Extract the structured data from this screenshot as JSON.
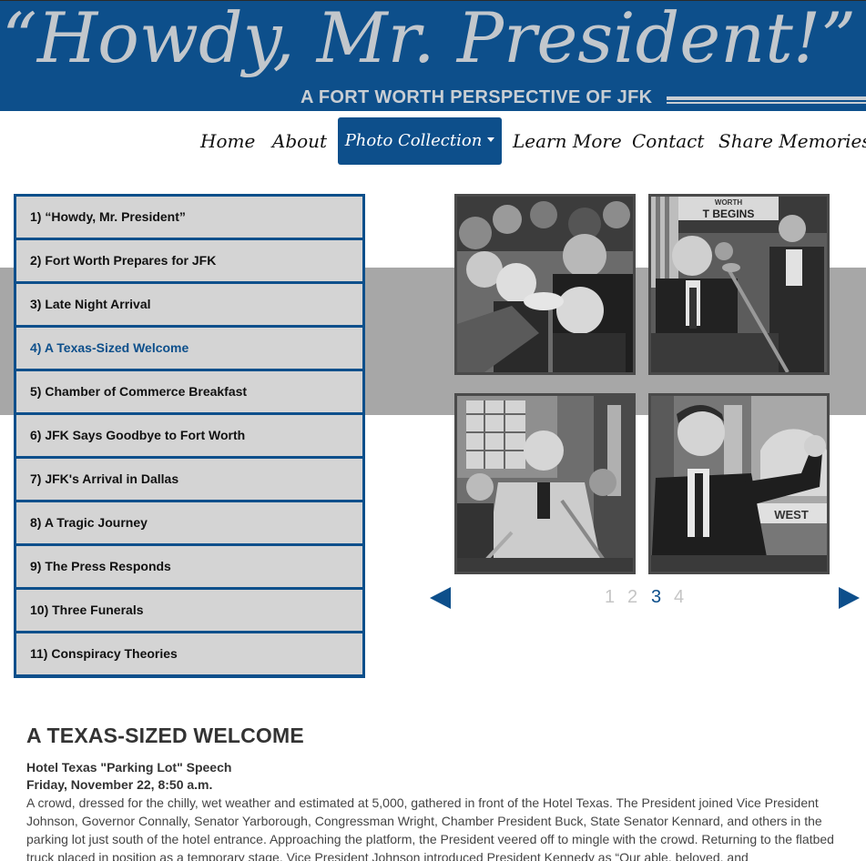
{
  "header": {
    "title": "“Howdy, Mr. President!”",
    "subtitle": "A FORT WORTH PERSPECTIVE OF JFK"
  },
  "nav": {
    "items": [
      {
        "label": "Home"
      },
      {
        "label": "About"
      },
      {
        "label": "Photo Collection",
        "active": true
      },
      {
        "label": "Learn More"
      },
      {
        "label": "Contact"
      },
      {
        "label": "Share Memories"
      }
    ]
  },
  "chapters": [
    {
      "label": "1) “Howdy, Mr. President”"
    },
    {
      "label": "2) Fort Worth Prepares for JFK"
    },
    {
      "label": "3) Late Night Arrival"
    },
    {
      "label": "4) A Texas-Sized Welcome",
      "active": true
    },
    {
      "label": "5) Chamber of Commerce Breakfast"
    },
    {
      "label": "6) JFK Says Goodbye to Fort Worth"
    },
    {
      "label": "7) JFK's Arrival in Dallas"
    },
    {
      "label": "8) A Tragic Journey"
    },
    {
      "label": "9) The Press Responds"
    },
    {
      "label": "10) Three Funerals"
    },
    {
      "label": "11) Conspiracy Theories"
    }
  ],
  "photos": {
    "photo2_sign_text": "T BEGINS",
    "photo2_sign_top": "WORTH",
    "photo4_sign_text": "WEST"
  },
  "pager": {
    "pages": [
      "1",
      "2",
      "3",
      "4"
    ],
    "current": "3"
  },
  "article": {
    "title": "A TEXAS-SIZED WELCOME",
    "subtitle_1": "Hotel Texas \"Parking Lot\" Speech",
    "subtitle_2": "Friday, November 22, 8:50 a.m.",
    "body": "A crowd, dressed for the chilly, wet weather and estimated at 5,000, gathered in front of the Hotel Texas. The President joined Vice President Johnson, Governor Connally, Senator Yarborough, Congressman Wright, Chamber President Buck, State Senator Kennard, and others in the parking lot just south of the hotel entrance. Approaching the platform, the President veered off to mingle with the crowd. Returning to the flatbed truck placed in position as a temporary stage, Vice President Johnson introduced President Kennedy as “Our able, beloved, and"
  },
  "colors": {
    "brand_blue": "#0d4f8b",
    "banner_text": "#c2c7cc",
    "band_grey": "#a7a7a7",
    "chapter_bg": "#d4d4d4"
  }
}
